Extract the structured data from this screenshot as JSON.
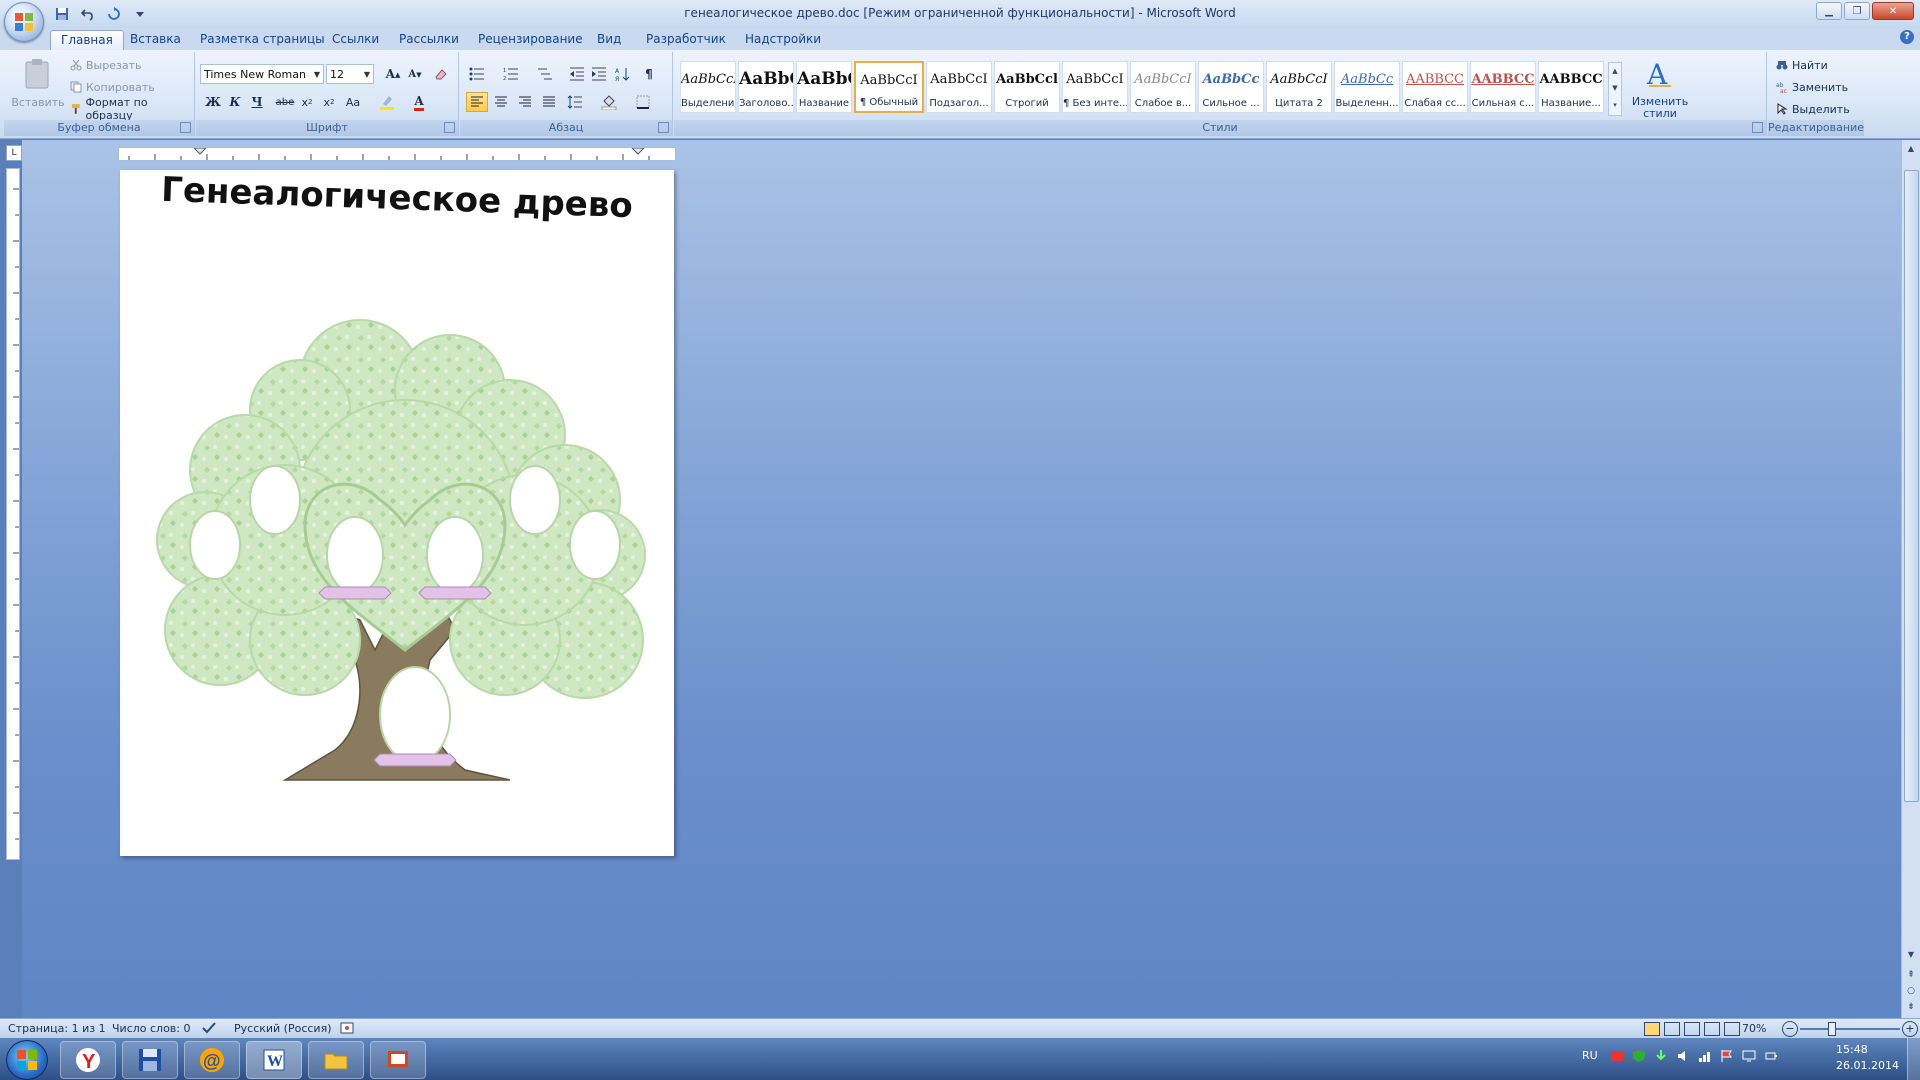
{
  "window": {
    "title": "генеалогическое древо.doc [Режим ограниченной функциональности] - Microsoft Word"
  },
  "tabs": [
    {
      "label": "Главная"
    },
    {
      "label": "Вставка"
    },
    {
      "label": "Разметка страницы"
    },
    {
      "label": "Ссылки"
    },
    {
      "label": "Рассылки"
    },
    {
      "label": "Рецензирование"
    },
    {
      "label": "Вид"
    },
    {
      "label": "Разработчик"
    },
    {
      "label": "Надстройки"
    }
  ],
  "ribbon": {
    "clipboard": {
      "label": "Буфер обмена",
      "paste": "Вставить",
      "cut": "Вырезать",
      "copy": "Копировать",
      "format_painter": "Формат по образцу"
    },
    "font": {
      "label": "Шрифт",
      "font_name": "Times New Roman",
      "font_size": "12"
    },
    "paragraph": {
      "label": "Абзац"
    },
    "styles": {
      "label": "Стили",
      "change_styles": "Изменить стили",
      "items": [
        {
          "sample": "AaBbCcI",
          "name": "Выделение"
        },
        {
          "sample": "AaBbC",
          "name": "Заголово..."
        },
        {
          "sample": "AaBbC",
          "name": "Название"
        },
        {
          "sample": "AaBbCcI",
          "name": "¶ Обычный"
        },
        {
          "sample": "AaBbCcI",
          "name": "Подзагол..."
        },
        {
          "sample": "AaBbCcl",
          "name": "Строгий"
        },
        {
          "sample": "AaBbCcI",
          "name": "¶ Без инте..."
        },
        {
          "sample": "AaBbCcI",
          "name": "Слабое в..."
        },
        {
          "sample": "AaBbCc",
          "name": "Сильное ..."
        },
        {
          "sample": "AaBbCcI",
          "name": "Цитата 2"
        },
        {
          "sample": "AaBbCc",
          "name": "Выделенн..."
        },
        {
          "sample": "AABBCC",
          "name": "Слабая сс..."
        },
        {
          "sample": "AABBCC",
          "name": "Сильная с..."
        },
        {
          "sample": "AABBCC",
          "name": "Название..."
        }
      ]
    },
    "editing": {
      "label": "Редактирование",
      "find": "Найти",
      "replace": "Заменить",
      "select": "Выделить"
    }
  },
  "document": {
    "heading": "Генеалогическое древо"
  },
  "statusbar": {
    "page": "Страница: 1 из 1",
    "words": "Число слов: 0",
    "language": "Русский (Россия)",
    "zoom": "70%"
  },
  "taskbar": {
    "lang": "RU",
    "time": "15:48",
    "date": "26.01.2014"
  },
  "colors": {
    "accent": "#15428b",
    "tree_leaves": "#cfe8c3",
    "tree_trunk": "#8a7a5e",
    "ribbons": "#e2c2e6"
  }
}
